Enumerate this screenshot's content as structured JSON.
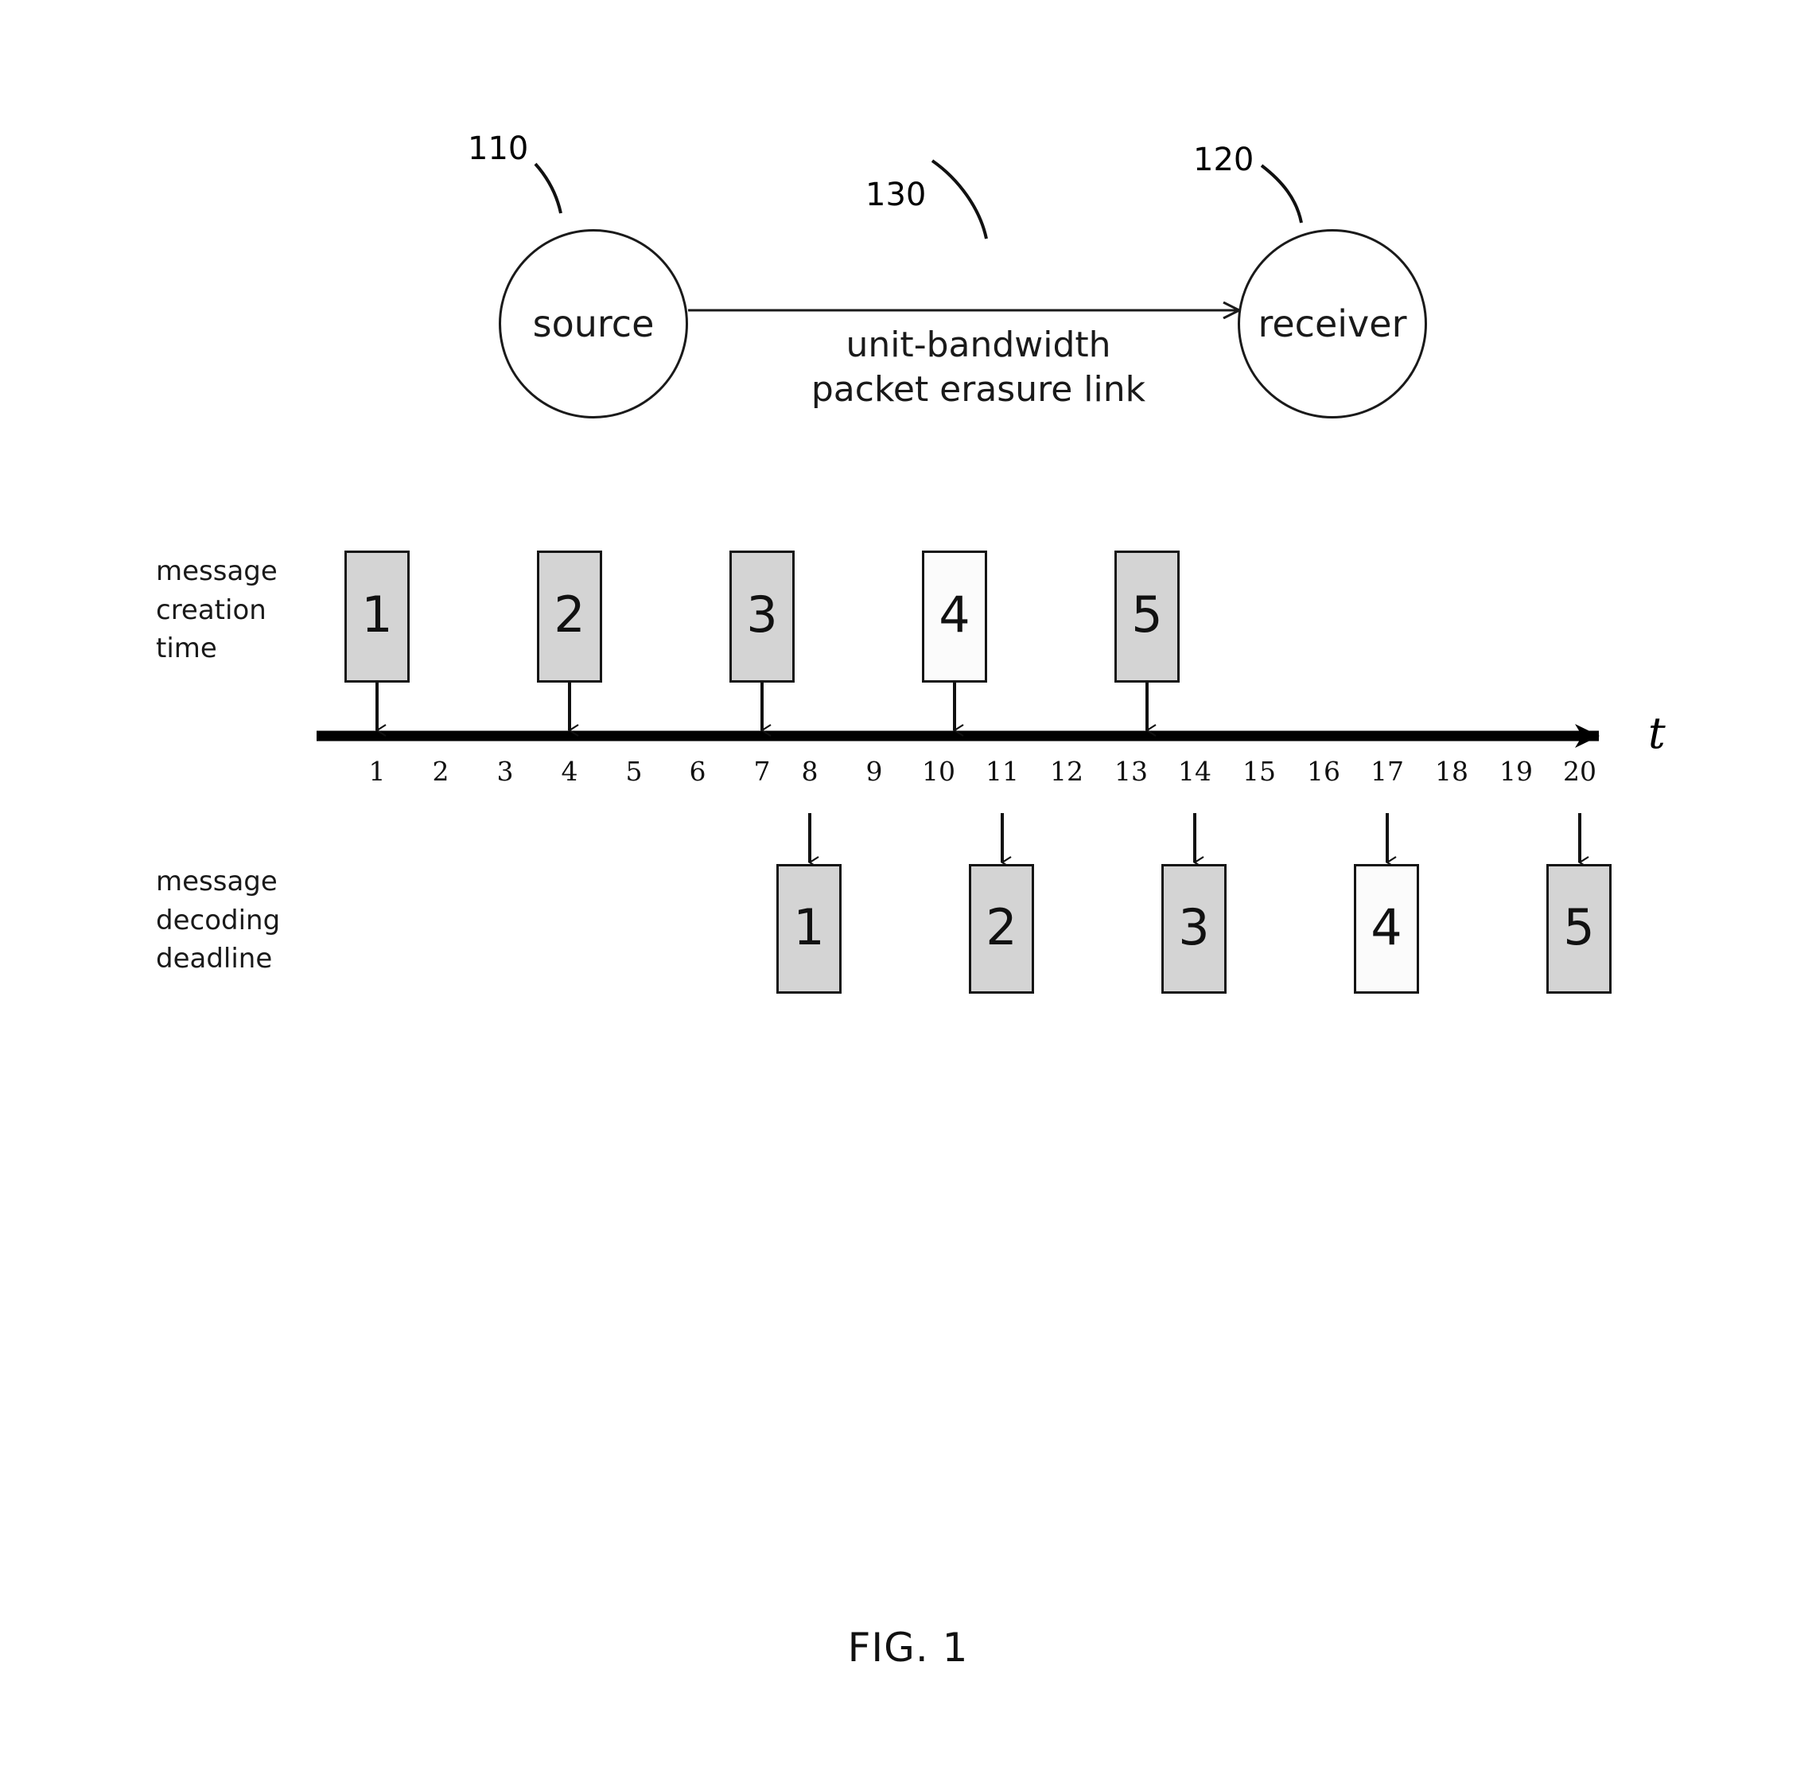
{
  "figure": {
    "caption": "FIG. 1"
  },
  "network": {
    "source": {
      "label": "source",
      "ref": "110"
    },
    "receiver": {
      "label": "receiver",
      "ref": "120"
    },
    "link": {
      "ref": "130",
      "caption_line1": "unit-bandwidth",
      "caption_line2": "packet erasure link"
    }
  },
  "timeline": {
    "axis_variable": "t",
    "ticks": [
      "1",
      "2",
      "3",
      "4",
      "5",
      "6",
      "7",
      "8",
      "9",
      "10",
      "11",
      "12",
      "13",
      "14",
      "15",
      "16",
      "17",
      "18",
      "19",
      "20"
    ]
  },
  "creation": {
    "label_line1": "message",
    "label_line2": "creation",
    "label_line3": "time",
    "messages": [
      {
        "id": "1",
        "time": 1,
        "shade": "gray"
      },
      {
        "id": "2",
        "time": 4,
        "shade": "gray"
      },
      {
        "id": "3",
        "time": 7,
        "shade": "gray"
      },
      {
        "id": "4",
        "time": 10,
        "shade": "light"
      },
      {
        "id": "5",
        "time": 13,
        "shade": "gray"
      }
    ]
  },
  "deadline": {
    "label_line1": "message",
    "label_line2": "decoding",
    "label_line3": "deadline",
    "messages": [
      {
        "id": "1",
        "time": 8,
        "shade": "gray"
      },
      {
        "id": "2",
        "time": 11,
        "shade": "gray"
      },
      {
        "id": "3",
        "time": 14,
        "shade": "gray"
      },
      {
        "id": "4",
        "time": 17,
        "shade": "light"
      },
      {
        "id": "5",
        "time": 20,
        "shade": "gray"
      }
    ]
  },
  "chart_data": {
    "type": "table",
    "title": "FIG. 1 — message creation times and decoding deadlines",
    "xlabel": "t",
    "categories": [
      "1",
      "2",
      "3",
      "4",
      "5"
    ],
    "series": [
      {
        "name": "message creation time",
        "values": [
          1,
          4,
          7,
          10,
          13
        ]
      },
      {
        "name": "message decoding deadline",
        "values": [
          8,
          11,
          14,
          17,
          20
        ]
      }
    ],
    "xlim": [
      1,
      20
    ],
    "tick_labels": [
      "1",
      "2",
      "3",
      "4",
      "5",
      "6",
      "7",
      "8",
      "9",
      "10",
      "11",
      "12",
      "13",
      "14",
      "15",
      "16",
      "17",
      "18",
      "19",
      "20"
    ],
    "grid": false,
    "legend": "none"
  },
  "colors": {
    "ink": "#111111",
    "box_gray": "#d4d4d4",
    "box_light": "#fbfbfb",
    "paper": "#ffffff"
  }
}
